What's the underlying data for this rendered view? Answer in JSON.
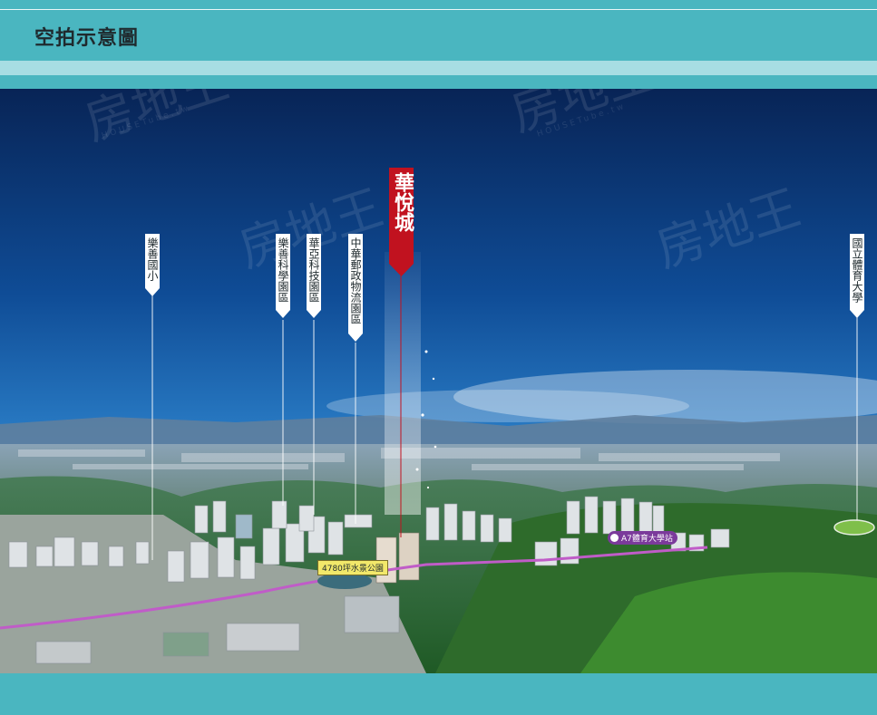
{
  "header": {
    "title": "空拍示意圖"
  },
  "markers": {
    "project": "華悅城",
    "school": "樂善國小",
    "science_park": "樂善科學園區",
    "tech_park": "華亞科技園區",
    "post_park": "中華郵政物流園區",
    "university": "國立體育大學"
  },
  "map_labels": {
    "park": "4780坪水景公園",
    "station": "A7體育大學站"
  },
  "watermark": {
    "brand": "房地王",
    "site": "HOUSETube.tw"
  },
  "colors": {
    "frame": "#4ab6c0",
    "stripe": "#a7dde3",
    "project_marker": "#c1121f",
    "sky_top": "#0a2d66",
    "sky_bottom": "#4a9fd8"
  }
}
